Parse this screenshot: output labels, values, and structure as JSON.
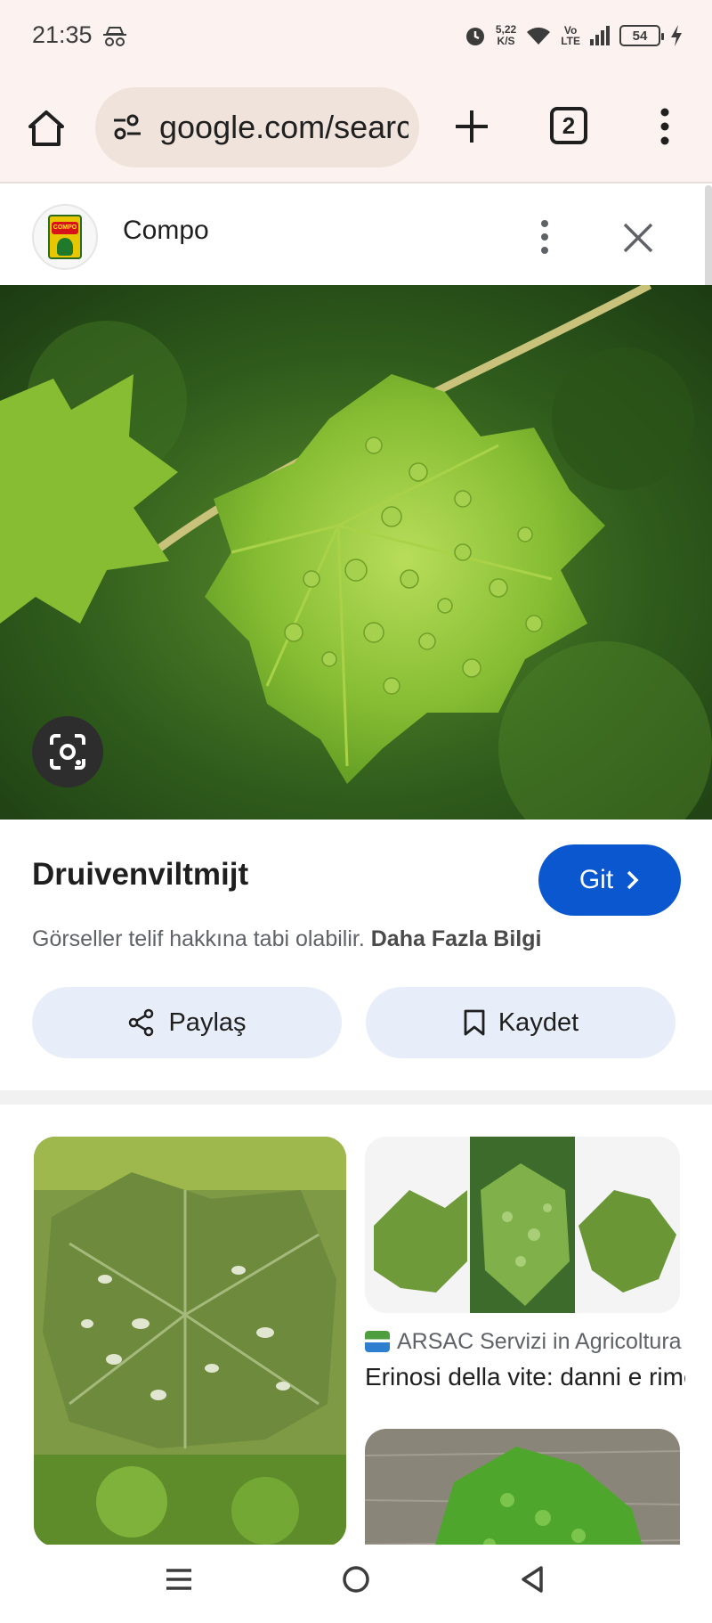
{
  "status_bar": {
    "time": "21:35",
    "speed_value": "5,22",
    "speed_unit": "K/S",
    "volte_top": "Vo",
    "volte_bottom": "LTE",
    "battery": "54",
    "icons": [
      "incognito-icon",
      "alarm-icon",
      "wifi-icon",
      "signal-icon",
      "battery-icon",
      "charging-icon"
    ]
  },
  "browser": {
    "url": "google.com/search",
    "tab_count": "2",
    "icons": [
      "home-icon",
      "site-settings-icon",
      "new-tab-icon",
      "tabs-icon",
      "more-icon"
    ]
  },
  "panel": {
    "site_name": "Compo",
    "logo_text": "COMPO",
    "title": "Druivenviltmijt",
    "go_button": "Git",
    "copyright_text": "Görseller telif hakkına tabi olabilir.",
    "more_info_link": "Daha Fazla Bilgi",
    "share_button": "Paylaş",
    "save_button": "Kaydet"
  },
  "related": {
    "source": "ARSAC Servizi in Agricoltura",
    "title": "Erinosi della vite: danni e rimedi"
  },
  "colors": {
    "accent": "#0b57d0",
    "toolbar_bg": "#fcf2ef",
    "chip_bg": "#e8eef9"
  }
}
